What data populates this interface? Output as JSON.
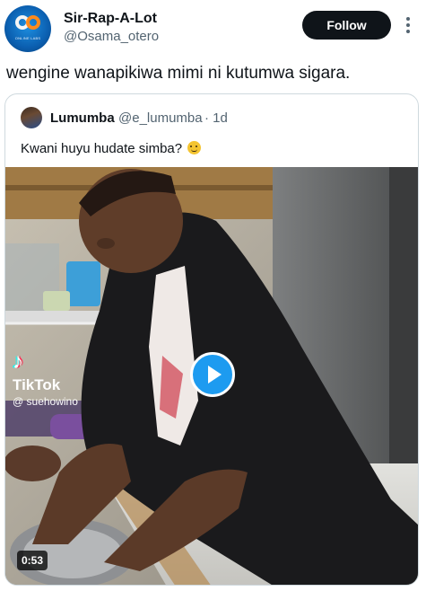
{
  "post": {
    "author_name": "Sir-Rap-A-Lot",
    "author_handle": "@Osama_otero",
    "avatar_text": "ONLINE LABS",
    "follow_label": "Follow",
    "text": "wengine wanapikiwa mimi ni kutumwa sigara."
  },
  "quoted": {
    "author_name": "Lumumba",
    "author_handle": "@e_lumumba",
    "time": "· 1d",
    "text": "Kwani huyu hudate simba?",
    "emoji": "slightly-smiling-face",
    "media": {
      "type": "video",
      "watermark_brand": "TikTok",
      "watermark_user": "@ suehowino",
      "duration": "0:53"
    }
  },
  "colors": {
    "follow_bg": "#0f1419",
    "play_accent": "#1d9bf0",
    "secondary_text": "#536471",
    "border": "#cfd9de"
  },
  "icons": [
    "more-icon",
    "play-icon",
    "tiktok-logo-icon",
    "emoji-smile-icon"
  ]
}
